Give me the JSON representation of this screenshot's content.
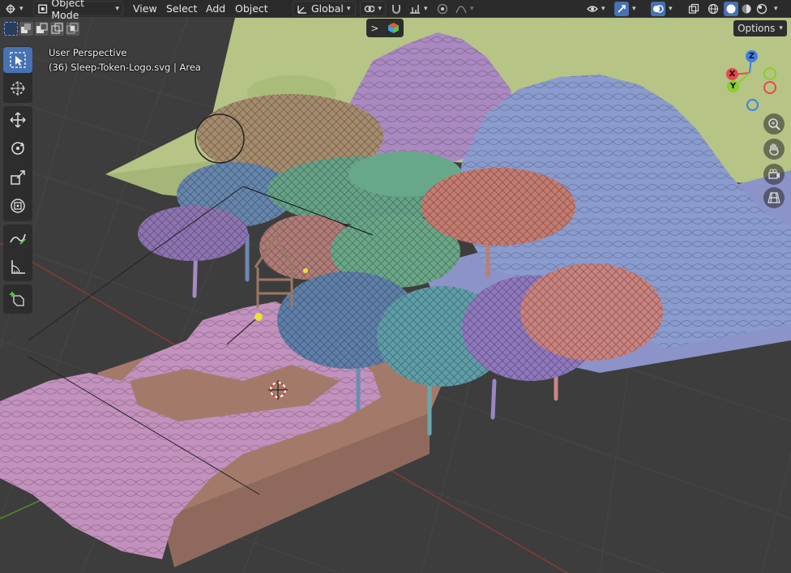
{
  "header": {
    "mode_label": "Object Mode",
    "menus": [
      "View",
      "Select",
      "Add",
      "Object"
    ],
    "orientation_label": "Global",
    "options_label": "Options"
  },
  "viewport": {
    "perspective_label": "User Perspective",
    "object_info": "(36) Sleep-Token-Logo.svg | Area"
  },
  "gizmo": {
    "z": "Z",
    "x": "X",
    "y": "Y"
  },
  "toolbar_tools": [
    "select-box",
    "cursor",
    "move",
    "rotate",
    "scale",
    "transform",
    "annotate",
    "measure",
    "add-cube"
  ],
  "nav_buttons": [
    "zoom-icon",
    "hand-icon",
    "camera-icon",
    "grid-icon"
  ],
  "colors": {
    "accent": "#4772b3",
    "header_bg": "#2a2a2a",
    "grid_bg": "#3d3d3d"
  }
}
